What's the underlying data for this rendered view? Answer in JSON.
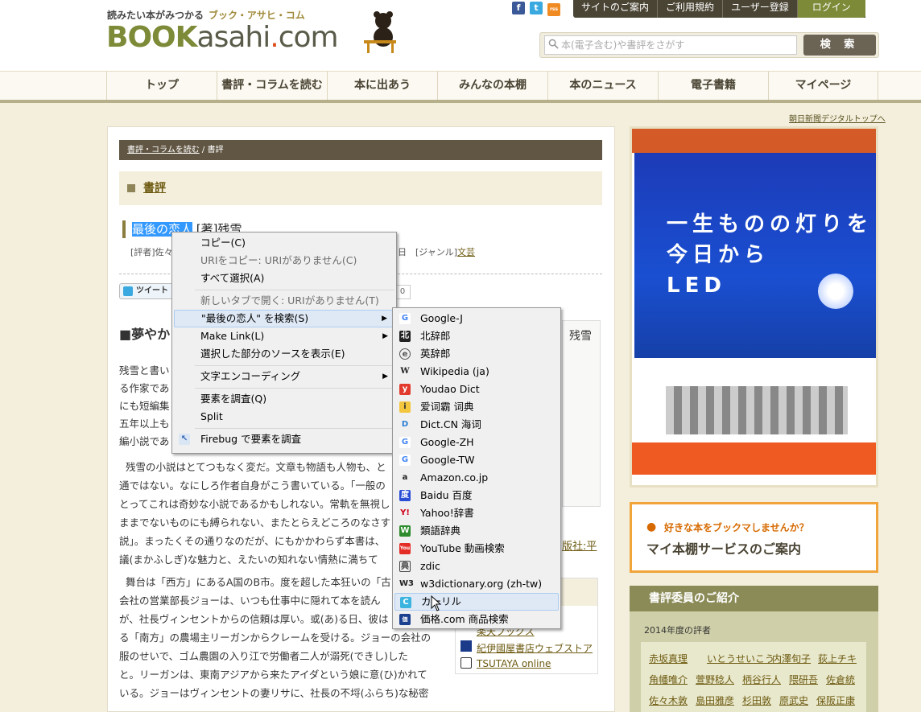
{
  "header": {
    "tagline": "読みたい本がみつかる",
    "tagline_kana": "ブック・アサヒ・コム",
    "logo_book": "BOOK",
    "logo_asahi": "asahi",
    "logo_dot": ".",
    "logo_com": "com",
    "social": [
      "f",
      "t",
      "rss"
    ],
    "topnav": [
      "サイトのご案内",
      "ご利用規約",
      "ユーザー登録"
    ],
    "login": "ログイン",
    "search_placeholder": "本(電子含む)や書評をさがす",
    "search_button": "検 索"
  },
  "nav": [
    "トップ",
    "書評・コラムを読む",
    "本に出あう",
    "みんなの本棚",
    "本のニュース",
    "電子書籍",
    "マイページ"
  ],
  "asahi_link": "朝日新聞デジタルトップへ",
  "content": {
    "breadcrumb_1": "書評・コラムを読む",
    "breadcrumb_sep": "/",
    "breadcrumb_2": "書評",
    "section_title": "書評",
    "book_title_selected": "最後の恋人",
    "book_author": "[著]残雪",
    "meta_reviewer": "[評者]佐々",
    "meta_date": "日",
    "meta_genre_label": "[ジャンル]",
    "meta_genre": "文芸",
    "tweet": "ツイート",
    "count": "0",
    "heading": "■夢やか",
    "book_cover_title": "残雪",
    "publisher": "版社:平",
    "paragraphs": [
      "残雪と書い",
      "る作家であ",
      "にも短編集",
      "五年以上も",
      "編小説であ",
      "残雪の小説はとてつもなく変だ。文章も物語も人物も、と",
      "通ではない。なにしろ作者自身がこう書いている。「一般の",
      "とってこれは奇妙な小説であるかもしれない。常軌を無視し",
      "ままでないものにも縛られない、またとらえどころのなさす",
      "説」。まったくその通りなのだが、にもかかわらず本書は、",
      "議(まかふしぎ)な魅力と、えたいの知れない情熱に満ちて",
      "舞台は「西方」にあるA国のB市。度を超した本狂いの「古",
      "会社の営業部長ジョーは、いつも仕事中に隠れて本を読ん",
      "が、社長ヴィンセントからの信頼は厚い。或(あ)る日、彼は",
      "る「南方」の農場主リーガンからクレームを受ける。ジョーの会社の",
      "服のせいで、ゴム農園の入り江で労働者二人が溺死(できし)した",
      "と。リーガンは、東南アジアから来たアイダという娘に意(ひ)かれて",
      "いる。ジョーはヴィンセントの妻リサに、社長の不埒(ふらち)な秘密"
    ],
    "shops": [
      "楽天ブックス",
      "紀伊國屋書店ウェブストア",
      "TSUTAYA online"
    ]
  },
  "sidebar": {
    "ad_big_lines": [
      "一生ものの灯りを",
      "今日から",
      "LED"
    ],
    "mybox_line1": "好きな本をブックマしませんか？",
    "mybox_line2": "マイ本棚サービスのご案内",
    "reviewers_title": "書評委員のご紹介",
    "reviewers_year": "2014年度の評者",
    "reviewers": [
      [
        "赤坂真理",
        "いとうせいこう",
        "内澤旬子",
        "荻上チキ"
      ],
      [
        "角幡唯介",
        "萱野稔人",
        "柄谷行人",
        "隈研吾",
        "佐倉統"
      ],
      [
        "佐々木敦",
        "島田雅彦",
        "杉田敦",
        "原武史",
        "保阪正康"
      ]
    ]
  },
  "context_menu": {
    "items": [
      {
        "label": "コピー(C)",
        "disabled": false
      },
      {
        "label": "URIをコピー: URIがありません(C)",
        "disabled": true
      },
      {
        "label": "すべて選択(A)",
        "disabled": false
      },
      {
        "label": "新しいタブで開く: URIがありません(T)",
        "disabled": true
      },
      {
        "label": "\"最後の恋人\" を検索(S)",
        "disabled": false
      },
      {
        "label": "Make Link(L)",
        "disabled": false
      },
      {
        "label": "選択した部分のソースを表示(E)",
        "disabled": false
      },
      {
        "label": "文字エンコーディング",
        "disabled": false
      },
      {
        "label": "要素を調査(Q)",
        "disabled": false
      },
      {
        "label": "Split",
        "disabled": false
      },
      {
        "label": "Firebug で要素を調査",
        "disabled": false
      }
    ]
  },
  "search_submenu": {
    "items": [
      {
        "label": "Google-J",
        "icon": "google-icon"
      },
      {
        "label": "北辞郎",
        "icon": "kitajiro-icon"
      },
      {
        "label": "英辞郎",
        "icon": "eijiro-icon"
      },
      {
        "label": "Wikipedia (ja)",
        "icon": "wikipedia-icon"
      },
      {
        "label": "Youdao Dict",
        "icon": "youdao-icon"
      },
      {
        "label": "爱词霸 词典",
        "icon": "iciba-icon"
      },
      {
        "label": "Dict.CN 海词",
        "icon": "dictcn-icon"
      },
      {
        "label": "Google-ZH",
        "icon": "google-icon"
      },
      {
        "label": "Google-TW",
        "icon": "google-icon"
      },
      {
        "label": "Amazon.co.jp",
        "icon": "amazon-icon"
      },
      {
        "label": "Baidu 百度",
        "icon": "baidu-icon"
      },
      {
        "label": "Yahoo!辞書",
        "icon": "yahoo-icon"
      },
      {
        "label": "類語辞典",
        "icon": "ruigo-icon"
      },
      {
        "label": "YouTube 動画検索",
        "icon": "youtube-icon"
      },
      {
        "label": "zdic",
        "icon": "zdic-icon"
      },
      {
        "label": "w3dictionary.org (zh-tw)",
        "icon": "w3dictionary-icon"
      },
      {
        "label": "カーリル",
        "icon": "calil-icon"
      },
      {
        "label": "価格.com 商品検索",
        "icon": "kakaku-icon"
      }
    ]
  }
}
